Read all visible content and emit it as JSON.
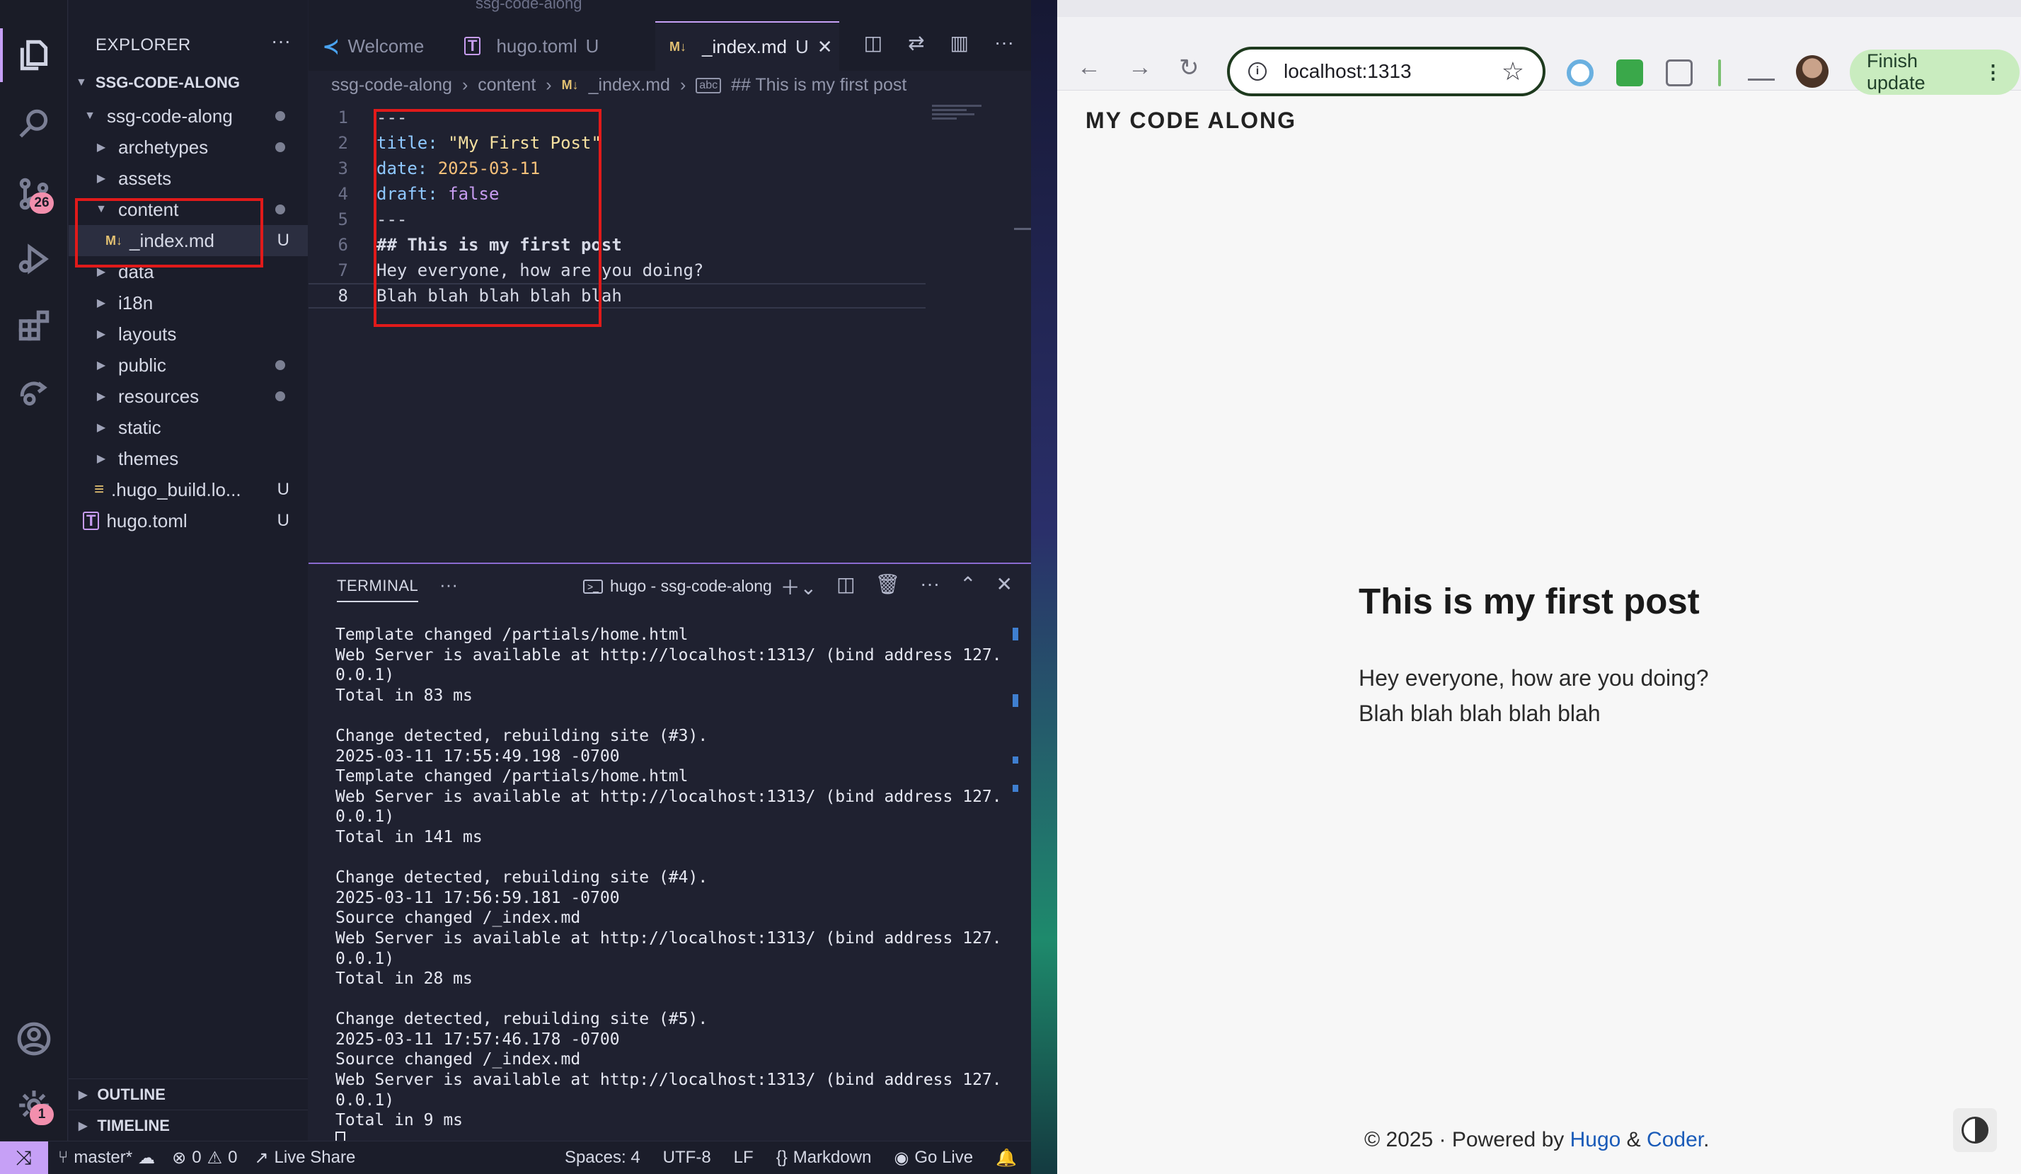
{
  "vscode": {
    "activity": {
      "scm_badge": "26",
      "settings_badge": "1"
    },
    "explorer": {
      "header": "EXPLORER",
      "more": "···",
      "root": "SSG-CODE-ALONG",
      "items": [
        {
          "label": "ssg-code-along",
          "kind": "folder-open",
          "marker": "dot"
        },
        {
          "label": "archetypes",
          "kind": "folder",
          "marker": "dot"
        },
        {
          "label": "assets",
          "kind": "folder",
          "marker": ""
        },
        {
          "label": "content",
          "kind": "folder-open",
          "marker": "dot"
        },
        {
          "label": "_index.md",
          "kind": "md",
          "marker": "U"
        },
        {
          "label": "data",
          "kind": "folder",
          "marker": ""
        },
        {
          "label": "i18n",
          "kind": "folder",
          "marker": ""
        },
        {
          "label": "layouts",
          "kind": "folder",
          "marker": ""
        },
        {
          "label": "public",
          "kind": "folder",
          "marker": "dot"
        },
        {
          "label": "resources",
          "kind": "folder",
          "marker": "dot"
        },
        {
          "label": "static",
          "kind": "folder",
          "marker": ""
        },
        {
          "label": "themes",
          "kind": "folder",
          "marker": ""
        },
        {
          "label": ".hugo_build.lo...",
          "kind": "lock",
          "marker": "U"
        },
        {
          "label": "hugo.toml",
          "kind": "toml",
          "marker": "U"
        }
      ],
      "outline": "OUTLINE",
      "timeline": "TIMELINE"
    },
    "top_tab_partial": "ssg-code-along",
    "tabs": [
      {
        "label": "Welcome",
        "status": ""
      },
      {
        "label": "hugo.toml",
        "status": "U"
      },
      {
        "label": "_index.md",
        "status": "U"
      }
    ],
    "breadcrumb": [
      "ssg-code-along",
      "content",
      "_index.md",
      "## This is my first post"
    ],
    "code_lines": [
      {
        "num": "1",
        "text": "---"
      },
      {
        "num": "2",
        "key": "title:",
        "val": " \"My First Post\""
      },
      {
        "num": "3",
        "key": "date:",
        "val": " 2025-03-11"
      },
      {
        "num": "4",
        "key": "draft:",
        "val": " false"
      },
      {
        "num": "5",
        "text": "---"
      },
      {
        "num": "6",
        "heading": "## This is my first post"
      },
      {
        "num": "7",
        "text": "Hey everyone, how are you doing?"
      },
      {
        "num": "8",
        "text": "Blah blah blah blah blah"
      }
    ],
    "terminal": {
      "tab": "TERMINAL",
      "title": "hugo - ssg-code-along",
      "lines": [
        "Template changed /partials/home.html",
        "Web Server is available at http://localhost:1313/ (bind address 127.",
        "0.0.1)",
        "Total in 83 ms",
        "",
        "Change detected, rebuilding site (#3).",
        "2025-03-11 17:55:49.198 -0700",
        "Template changed /partials/home.html",
        "Web Server is available at http://localhost:1313/ (bind address 127.",
        "0.0.1)",
        "Total in 141 ms",
        "",
        "Change detected, rebuilding site (#4).",
        "2025-03-11 17:56:59.181 -0700",
        "Source changed /_index.md",
        "Web Server is available at http://localhost:1313/ (bind address 127.",
        "0.0.1)",
        "Total in 28 ms",
        "",
        "Change detected, rebuilding site (#5).",
        "2025-03-11 17:57:46.178 -0700",
        "Source changed /_index.md",
        "Web Server is available at http://localhost:1313/ (bind address 127.",
        "0.0.1)",
        "Total in 9 ms"
      ]
    },
    "statusbar": {
      "branch": "master*",
      "errors": "0",
      "warnings": "0",
      "live_share": "Live Share",
      "spaces": "Spaces: 4",
      "encoding": "UTF-8",
      "eol": "LF",
      "language": "Markdown",
      "go_live": "Go Live"
    }
  },
  "browser": {
    "url": "localhost:1313",
    "finish_update": "Finish update",
    "site_title": "MY CODE ALONG",
    "post_title": "This is my first post",
    "post_lines": [
      "Hey everyone, how are you doing?",
      "Blah blah blah blah blah"
    ],
    "footer": {
      "prefix": "© 2025 · Powered by",
      "link1": "Hugo",
      "amp": "&",
      "link2": "Coder",
      "suffix": "."
    }
  },
  "colors": {
    "accent": "#c6a0f6",
    "highlight_box": "#e11a1a",
    "link": "#1a5bb8",
    "update_button": "#c9ecbf"
  }
}
